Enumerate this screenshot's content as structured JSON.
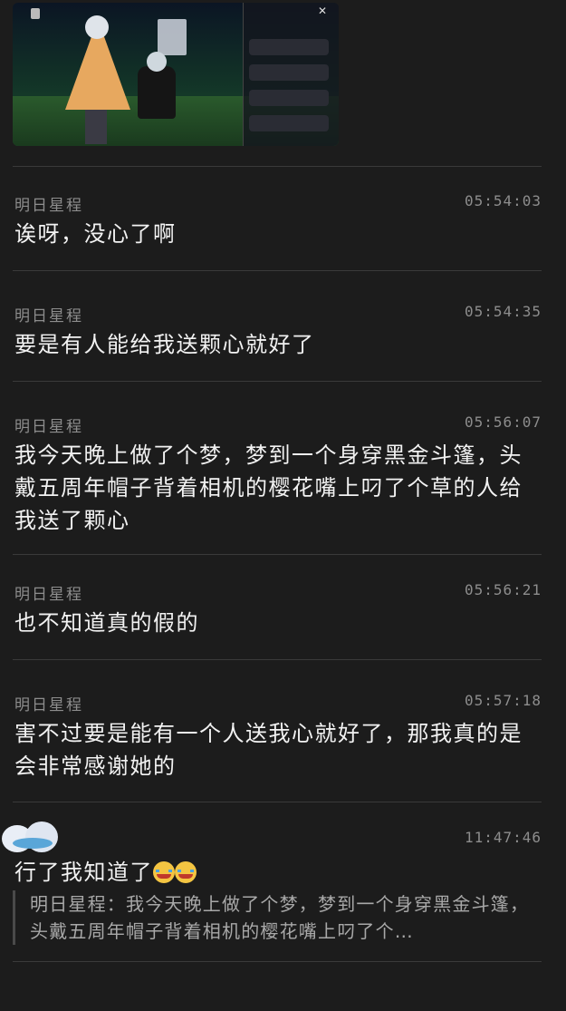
{
  "shared_image": {
    "panel_close_icon": "close-icon"
  },
  "messages": [
    {
      "sender": "明日星程",
      "time": "05:54:03",
      "text": "诶呀，没心了啊"
    },
    {
      "sender": "明日星程",
      "time": "05:54:35",
      "text": "要是有人能给我送颗心就好了"
    },
    {
      "sender": "明日星程",
      "time": "05:56:07",
      "text": "我今天晚上做了个梦，梦到一个身穿黑金斗篷，头戴五周年帽子背着相机的樱花嘴上叼了个草的人给我送了颗心"
    },
    {
      "sender": "明日星程",
      "time": "05:56:21",
      "text": "也不知道真的假的"
    },
    {
      "sender": "明日星程",
      "time": "05:57:18",
      "text": "害不过要是能有一个人送我心就好了，那我真的是会非常感谢她的"
    }
  ],
  "reply": {
    "time": "11:47:46",
    "text": "行了我知道了",
    "emoji": "crying-laughing-emoji",
    "quote": "明日星程：我今天晚上做了个梦，梦到一个身穿黑金斗篷，头戴五周年帽子背着相机的樱花嘴上叼了个…"
  }
}
